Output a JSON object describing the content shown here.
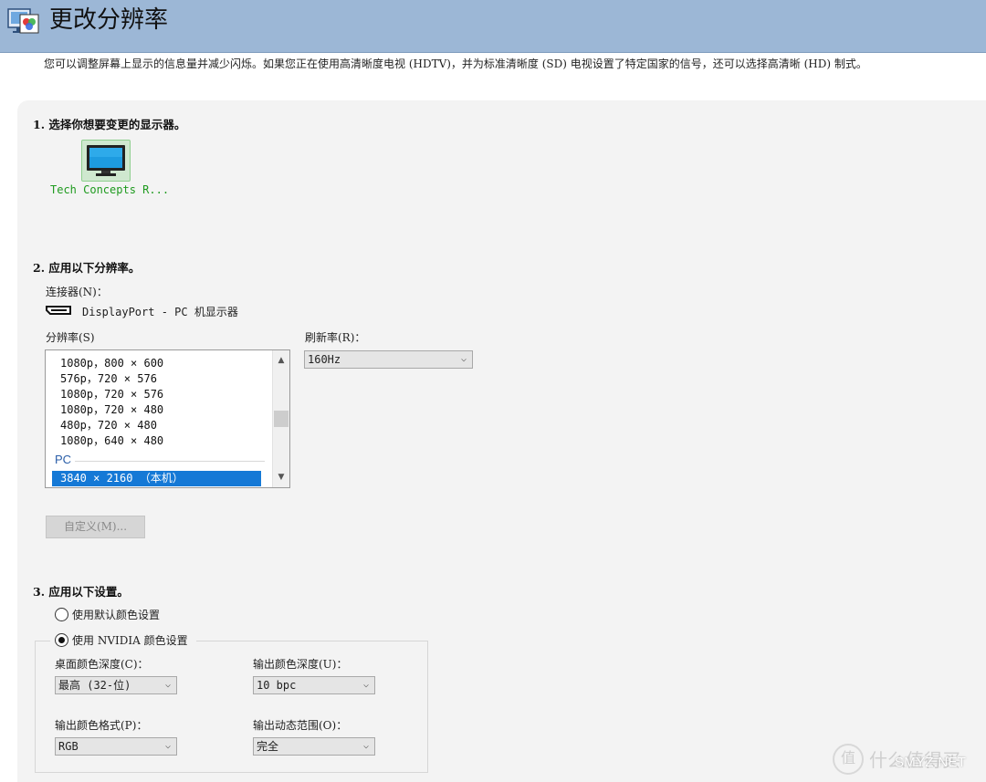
{
  "header": {
    "title": "更改分辨率"
  },
  "description": "您可以调整屏幕上显示的信息量并减少闪烁。如果您正在使用高清晰度电视 (HDTV)，并为标准清晰度 (SD) 电视设置了特定国家的信号，还可以选择高清晰 (HD) 制式。",
  "section1": {
    "title": "1. 选择你想要变更的显示器。",
    "monitor_label": "Tech Concepts R..."
  },
  "section2": {
    "title": "2. 应用以下分辨率。",
    "connector_label": "连接器(N)：",
    "connector_value": "DisplayPort - PC 机显示器",
    "resolution_label": "分辨率(S)",
    "resolutions": [
      "1080p，800 × 600",
      "576p，720 × 576",
      "1080p，720 × 576",
      "1080p，720 × 480",
      "480p，720 × 480",
      "1080p，640 × 480"
    ],
    "group_header": "PC",
    "selected_resolution": "3840 × 2160 （本机）",
    "refresh_label": "刷新率(R)：",
    "refresh_value": "160Hz",
    "custom_button": "自定义(M)..."
  },
  "section3": {
    "title": "3. 应用以下设置。",
    "radio_default": "使用默认颜色设置",
    "radio_nvidia": "使用 NVIDIA 颜色设置",
    "radio_selected": "nvidia",
    "desktop_depth_label": "桌面颜色深度(C)：",
    "desktop_depth_value": "最高 (32-位)",
    "output_depth_label": "输出颜色深度(U)：",
    "output_depth_value": "10 bpc",
    "output_format_label": "输出颜色格式(P)：",
    "output_format_value": "RGB",
    "output_range_label": "输出动态范围(O)：",
    "output_range_value": "完全"
  },
  "icons": {
    "header": "display-settings-icon",
    "monitor": "monitor-icon",
    "connector": "displayport-icon",
    "dropdown": "chevron-down-icon"
  },
  "colors": {
    "header_bg": "#9cb7d6",
    "selection": "#1579d6",
    "monitor_label": "#1e9a1e",
    "group_header": "#2a5ea8"
  },
  "watermark": {
    "badge": "值",
    "text": "什么值得买",
    "site": "SMYZ.NET"
  }
}
